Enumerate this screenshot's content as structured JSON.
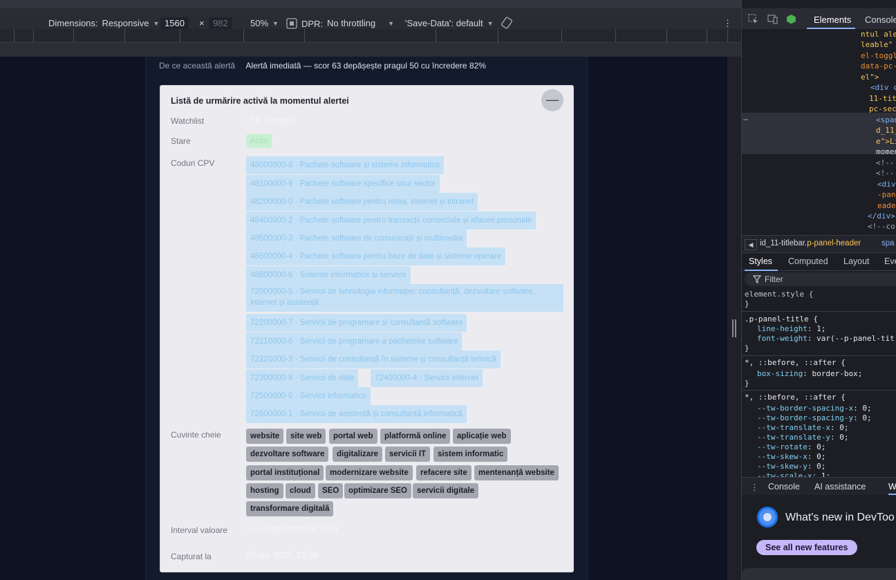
{
  "device_toolbar": {
    "dimensions_label": "Dimensions:",
    "device": "Responsive",
    "width": "1560",
    "times": "×",
    "height": "982",
    "zoom": "50%",
    "dpr_label": "DPR:",
    "throttling": "No throttling",
    "save_data": "'Save-Data': default",
    "more": "⋮"
  },
  "page": {
    "why_label": "De ce această alertă",
    "why_value": "Alertă imediată — scor 63 depășește pragul 50 cu încredere 82%",
    "panel": {
      "title": "Listă de urmărire activă la momentul alertei",
      "collapse_glyph": "—",
      "watchlist_label": "Watchlist",
      "watchlist_value": "IT & Software",
      "status_label": "Stare",
      "status_value": "Activ",
      "cpv_label": "Coduri CPV",
      "cpv_codes": [
        "48000000-8 · Pachete software și sisteme informatice",
        "48100000-9 · Pachete software specifice unui sector",
        "48200000-0 · Pachete software pentru rețea, internet și intranet",
        "48400000-2 · Pachete software pentru tranzacții comerciale și afaceri personale",
        "48500000-3 · Pachete software de comunicații și multimedia",
        "48600000-4 · Pachete software pentru baze de date și sisteme operare",
        "48800000-6 · Sisteme informatice și servere",
        "72000000-5 · Servicii de tehnologia informației: consultanță, dezvoltare software, internet și asistență",
        "72200000-7 · Servicii de programare și consultanță software",
        "72210000-0 · Servicii de programare a pachetelor software",
        "72220000-3 · Servicii de consultanță în sisteme și consultanță tehnică",
        "72300000-8 · Servicii de date",
        "72400000-4 · Servicii internet",
        "72500000-0 · Servicii informatice",
        "72600000-1 · Servicii de asistență și consultanță informatică"
      ],
      "keywords_label": "Cuvinte cheie",
      "keywords": [
        "website",
        "site web",
        "portal web",
        "platformă online",
        "aplicație web",
        "dezvoltare software",
        "digitalizare",
        "servicii IT",
        "sistem informatic",
        "portal instituțional",
        "modernizare website",
        "refacere site",
        "mentenanță website",
        "hosting",
        "cloud",
        "SEO",
        "optimizare SEO",
        "servicii digitale",
        "transformare digitală"
      ],
      "interval_label": "Interval valoare",
      "interval_value": "0 – 1000000000.00 RON",
      "captured_label": "Capturat la",
      "captured_value": "20 apr. 2025, 21:56"
    }
  },
  "devtools": {
    "tabs": [
      "Elements",
      "Console"
    ],
    "active_tab": "Elements",
    "tree_lines": [
      "ntul ale",
      "leable\"",
      "el-toggl",
      "data-pc-",
      "el\">",
      "<div c",
      "11-tit",
      "pc-sec",
      "<span",
      "d_11_",
      "e\">Li",
      "momen",
      "<!--",
      "<!--",
      "<div",
      "-pan",
      "eade",
      "</div>",
      "<!--co"
    ],
    "ellipsis": "…",
    "breadcrumb_prefix": "id_11-titlebar",
    "breadcrumb_class": ".p-panel-header",
    "breadcrumb_next": "spa",
    "style_tabs": [
      "Styles",
      "Computed",
      "Layout",
      "Eve"
    ],
    "filter_placeholder": "Filter",
    "css": {
      "element_style": "element.style {",
      "close": "}",
      "rule1_selector": ".p-panel-title {",
      "rule1_props": [
        [
          "line-height",
          "1;"
        ],
        [
          "font-weight",
          "var(--p-panel-tit"
        ]
      ],
      "rule2_selector": "*, ::before, ::after {",
      "rule2_props": [
        [
          "box-sizing",
          "border-box;"
        ]
      ],
      "rule3_selector": "*, ::before, ::after {",
      "rule3_props": [
        [
          "--tw-border-spacing-x",
          "0;"
        ],
        [
          "--tw-border-spacing-y",
          "0;"
        ],
        [
          "--tw-translate-x",
          "0;"
        ],
        [
          "--tw-translate-y",
          "0;"
        ],
        [
          "--tw-rotate",
          "0;"
        ],
        [
          "--tw-skew-x",
          "0;"
        ],
        [
          "--tw-skew-y",
          "0;"
        ],
        [
          "--tw-scale-x",
          "1;"
        ]
      ]
    },
    "drawer_tabs": [
      "Console",
      "AI assistance",
      "W"
    ],
    "whats_new_title": "What's new in DevToo",
    "whats_new_button": "See all new features"
  }
}
